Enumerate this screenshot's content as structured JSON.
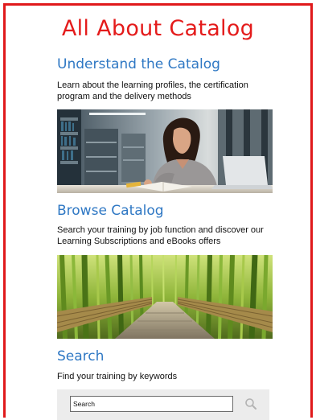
{
  "page": {
    "title": "All About Catalog"
  },
  "sections": [
    {
      "heading": "Understand the Catalog",
      "description": "Learn about the learning profiles, the certification program and the delivery methods",
      "image": "woman-studying-library-photo"
    },
    {
      "heading": "Browse Catalog",
      "description": "Search your training by job function and discover our Learning Subscriptions and eBooks offers",
      "image": "bamboo-forest-path-photo"
    },
    {
      "heading": "Search",
      "description": "Find your training by keywords"
    }
  ],
  "search": {
    "placeholder": "Search",
    "button_icon": "magnifier-icon"
  },
  "colors": {
    "border": "#e0191b",
    "title": "#e41b1b",
    "heading": "#2f78c4",
    "search_panel": "#ececec"
  }
}
